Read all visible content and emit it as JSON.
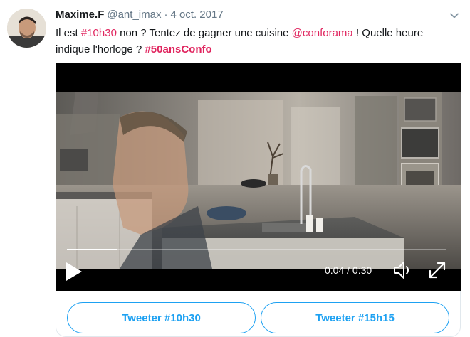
{
  "tweet": {
    "display_name": "Maxime.F",
    "handle": "@ant_imax",
    "separator": "·",
    "date": "4 oct. 2017",
    "text_segments": {
      "part1": "Il est ",
      "hashtag1": "#10h30",
      "part2": " non ? Tentez de gagner une cuisine ",
      "mention": "@conforama",
      "part3": " ! Quelle heure indique l'horloge ? ",
      "hashtag2": "#50ansConfo"
    }
  },
  "video": {
    "current_time": "0:04",
    "time_separator": " / ",
    "duration": "0:30",
    "progress_fraction": 0.133
  },
  "poll": {
    "option1_label": "Tweeter #10h30",
    "option2_label": "Tweeter #15h15"
  },
  "icons": {
    "caret": "chevron-down-icon",
    "play": "play-icon",
    "volume": "volume-icon",
    "expand": "fullscreen-icon"
  },
  "colors": {
    "accent": "#1da1f2",
    "hashtag": "#e0245e",
    "muted": "#657786"
  }
}
